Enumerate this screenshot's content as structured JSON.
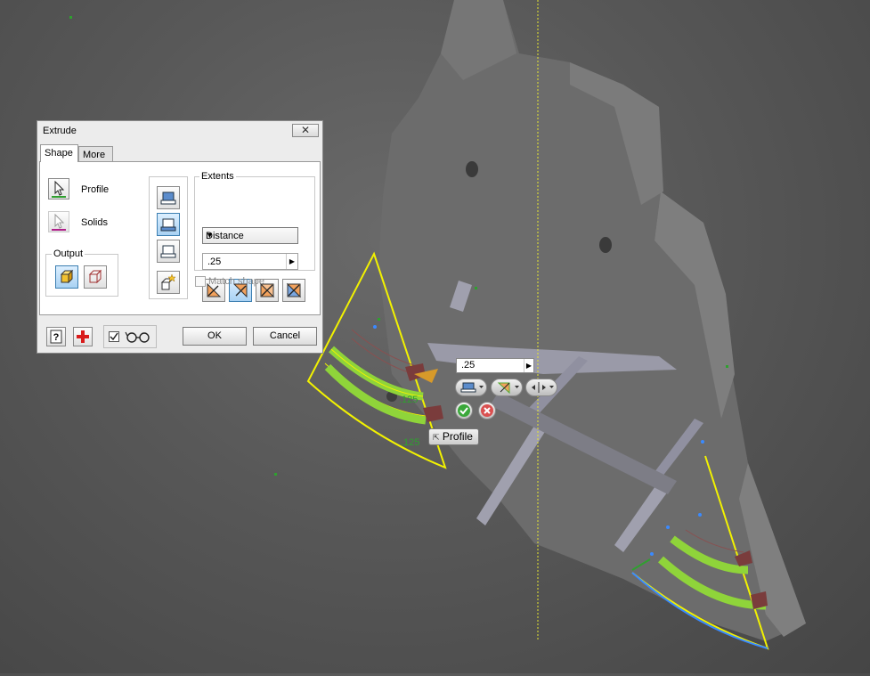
{
  "dialog": {
    "title": "Extrude",
    "close_label": "✕",
    "tabs": [
      {
        "label": "Shape"
      },
      {
        "label": "More"
      }
    ],
    "profile_label": "Profile",
    "solids_label": "Solids",
    "output_label": "Output",
    "extents_label": "Extents",
    "extents_type": "Distance",
    "distance_value": ".25",
    "match_shape_label": "Match shape",
    "match_shape_checked": false,
    "preview_checked": true,
    "ok_label": "OK",
    "cancel_label": "Cancel"
  },
  "mini_toolbar": {
    "distance_value": ".25",
    "profile_tooltip": "Profile"
  },
  "viewport": {
    "dimension_labels": [
      ".125",
      ".125"
    ],
    "colors": {
      "background": "#585858",
      "part_face": "#6f6f6f",
      "sketch_highlight": "#f2f200",
      "profile_fill": "#8fd43a",
      "selected_edge": "#3a8aff",
      "centerline": "#e8e830"
    }
  }
}
